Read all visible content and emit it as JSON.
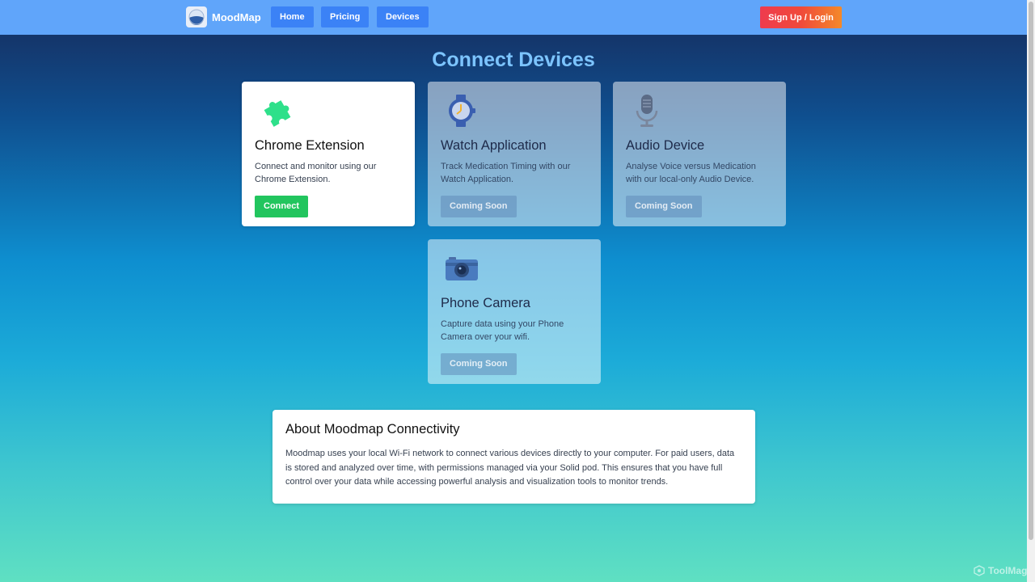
{
  "header": {
    "brand": "MoodMap",
    "nav": [
      "Home",
      "Pricing",
      "Devices"
    ],
    "signup": "Sign Up / Login"
  },
  "page_title": "Connect Devices",
  "cards": [
    {
      "title": "Chrome Extension",
      "desc": "Connect and monitor using our Chrome Extension.",
      "button": "Connect",
      "icon": "puzzle-icon"
    },
    {
      "title": "Watch Application",
      "desc": "Track Medication Timing with our Watch Application.",
      "button": "Coming Soon",
      "icon": "watch-icon"
    },
    {
      "title": "Audio Device",
      "desc": "Analyse Voice versus Medication with our local-only Audio Device.",
      "button": "Coming Soon",
      "icon": "microphone-icon"
    },
    {
      "title": "Phone Camera",
      "desc": "Capture data using your Phone Camera over your wifi.",
      "button": "Coming Soon",
      "icon": "camera-icon"
    }
  ],
  "about": {
    "title": "About Moodmap Connectivity",
    "body": "Moodmap uses your local Wi-Fi network to connect various devices directly to your computer. For paid users, data is stored and analyzed over time, with permissions managed via your Solid pod. This ensures that you have full control over your data while accessing powerful analysis and visualization tools to monitor trends."
  },
  "watermark": "ToolMage",
  "colors": {
    "header": "#60a5fa",
    "nav_button": "#3b82f6",
    "connect": "#22c55e",
    "title": "#7cc4ff"
  }
}
